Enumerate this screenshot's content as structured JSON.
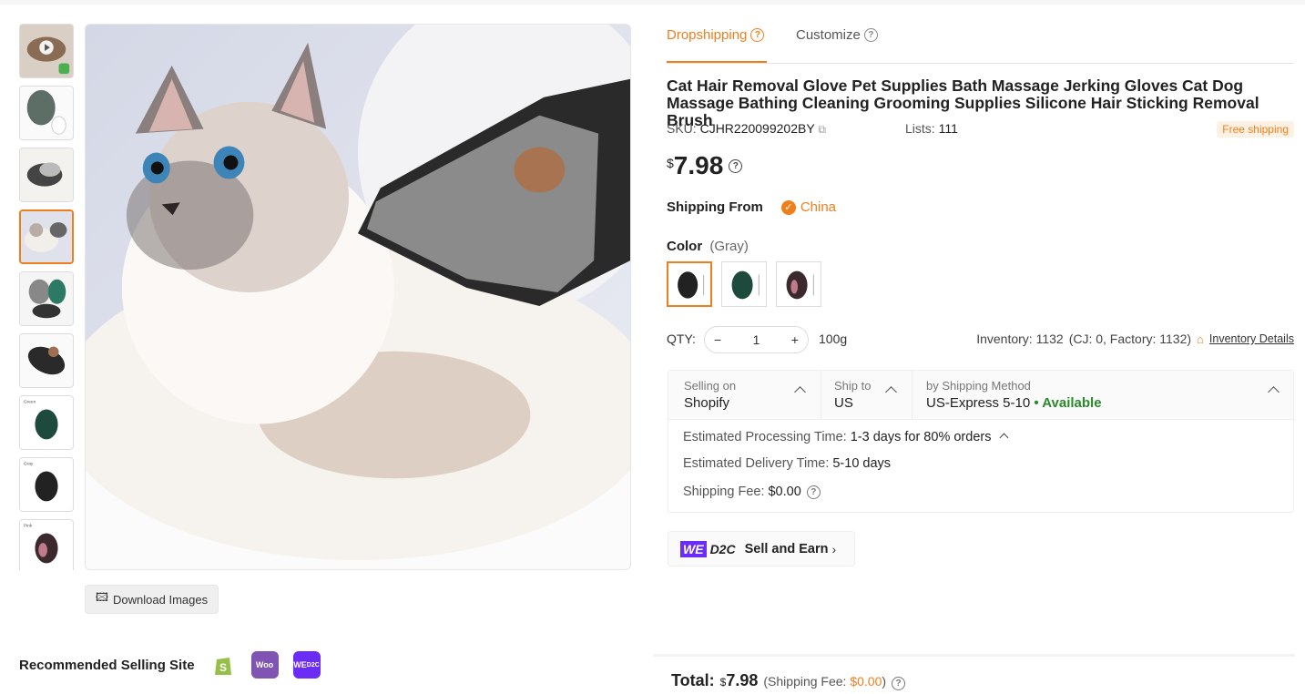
{
  "tabs": {
    "dropshipping": "Dropshipping",
    "customize": "Customize"
  },
  "product": {
    "title": "Cat Hair Removal Glove Pet Supplies Bath Massage Jerking Gloves Cat Dog Massage Bathing Cleaning Grooming Supplies Silicone Hair Sticking Removal Brush",
    "sku_label": "SKU:",
    "sku": "CJHR220099202BY",
    "lists_label": "Lists:",
    "lists": "111",
    "free_shipping": "Free shipping",
    "currency": "$",
    "price": "7.98"
  },
  "shipping_from": {
    "label": "Shipping From",
    "country": "China"
  },
  "color": {
    "label": "Color",
    "selected": "(Gray)",
    "options": [
      "Gray",
      "Green",
      "Pink"
    ]
  },
  "qty": {
    "label": "QTY:",
    "value": "1",
    "minus": "−",
    "plus": "+",
    "weight": "100g",
    "inventory": "Inventory: 1132",
    "inventory_breakdown": "(CJ: 0, Factory: 1132)",
    "inventory_details": "Inventory Details"
  },
  "shipping": {
    "selling_on_label": "Selling on",
    "selling_on": "Shopify",
    "ship_to_label": "Ship to",
    "ship_to": "US",
    "method_label": "by Shipping Method",
    "method": "US-Express 5-10",
    "availability": "• Available",
    "processing_label": "Estimated Processing Time:",
    "processing": "1-3 days for 80% orders",
    "delivery_label": "Estimated Delivery Time:",
    "delivery": "5-10 days",
    "fee_label": "Shipping Fee:",
    "fee": "$0.00"
  },
  "d2c": {
    "we": "WE",
    "d2c": "D2C",
    "label": "Sell and Earn"
  },
  "gallery": {
    "download": "Download Images",
    "recommended": "Recommended Selling Site",
    "thumb_labels": [
      "Green",
      "Gray",
      "Pink"
    ]
  },
  "sites": {
    "woo": "Woo",
    "we": "WE",
    "d2c": "D2C"
  },
  "total": {
    "label": "Total:",
    "currency": "$",
    "value": "7.98",
    "fee_prefix": "(Shipping Fee:",
    "fee": "$0.00",
    "fee_suffix": ")"
  },
  "colors": {
    "accent": "#ef7e1c",
    "available": "#2b8a2b",
    "d2c": "#6b2cf5",
    "shopify": "#95bf47",
    "woo": "#7f54b3"
  },
  "icons": [
    "help-icon",
    "copy-icon",
    "check-icon",
    "house-icon",
    "chevron-up-icon",
    "chevron-right-icon",
    "image-download-icon",
    "shopify-icon",
    "woocommerce-icon",
    "wed2c-icon",
    "play-icon"
  ]
}
